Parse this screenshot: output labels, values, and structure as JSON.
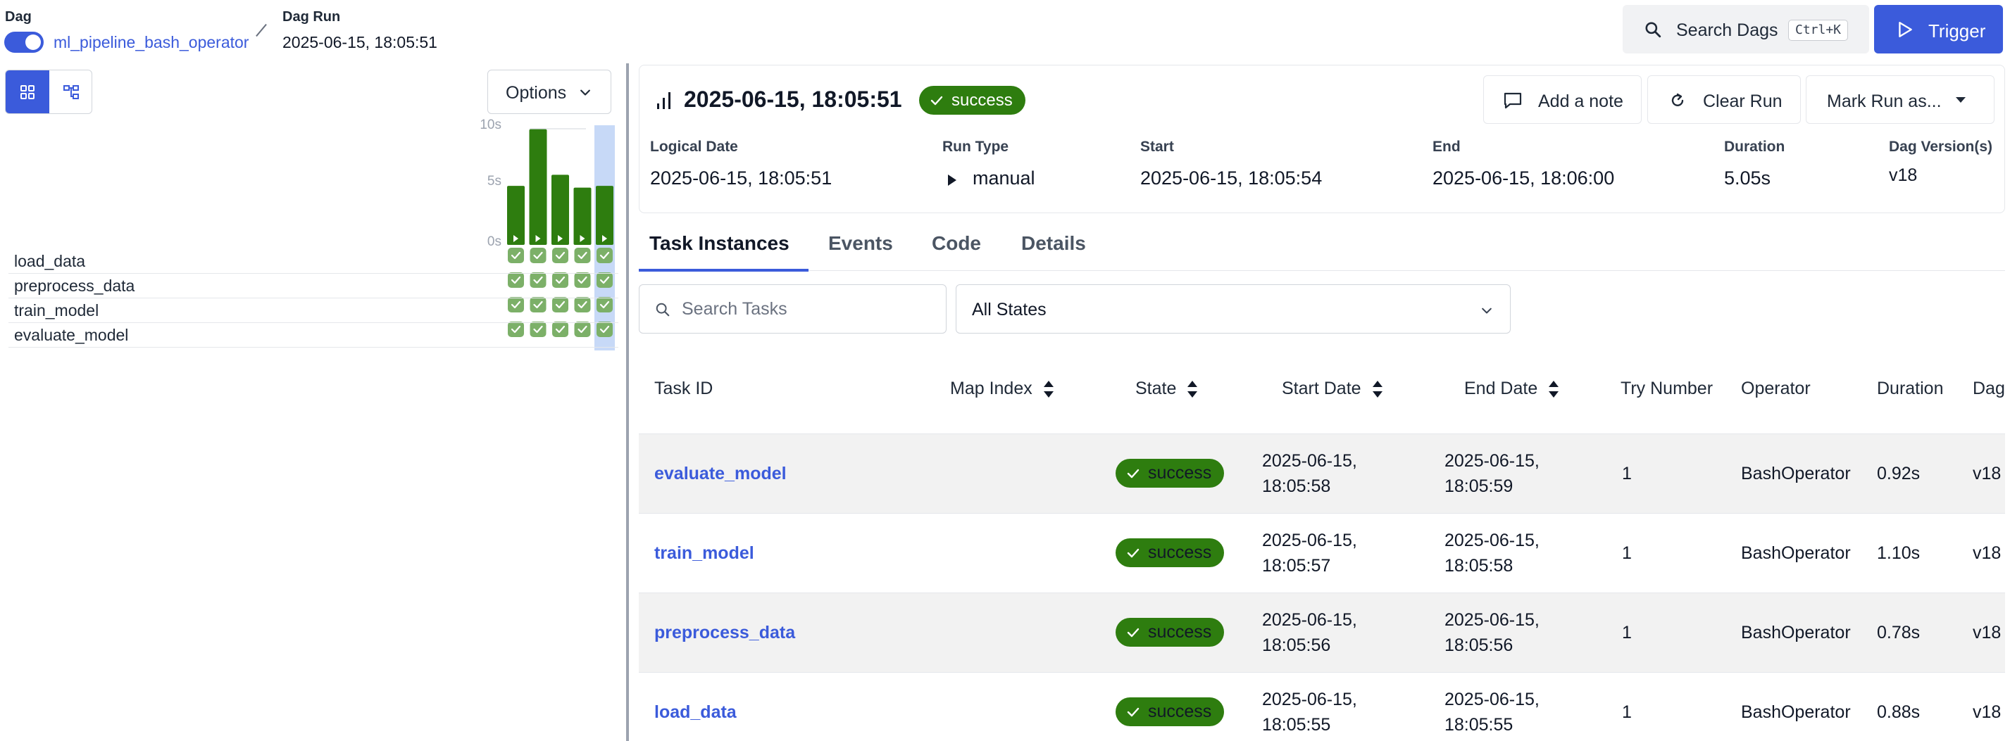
{
  "breadcrumb": {
    "dag_label": "Dag",
    "dag_name": "ml_pipeline_bash_operator",
    "run_label": "Dag Run",
    "run_value": "2025-06-15, 18:05:51"
  },
  "search_dags": {
    "label": "Search Dags",
    "shortcut": "Ctrl+K"
  },
  "trigger": {
    "label": "Trigger"
  },
  "grid": {
    "options_label": "Options",
    "axis_ticks": [
      "10s",
      "5s",
      "0s"
    ],
    "run_durations_s": [
      5.05,
      9.9,
      6.0,
      4.9,
      5.05
    ],
    "task_names": [
      "load_data",
      "preprocess_data",
      "train_model",
      "evaluate_model"
    ]
  },
  "run": {
    "title": "2025-06-15, 18:05:51",
    "state": "success",
    "add_note": "Add a note",
    "clear_run": "Clear Run",
    "mark_run": "Mark Run as...",
    "meta": [
      {
        "label": "Logical Date",
        "value": "2025-06-15, 18:05:51"
      },
      {
        "label": "Run Type",
        "value": "manual"
      },
      {
        "label": "Start",
        "value": "2025-06-15, 18:05:54"
      },
      {
        "label": "End",
        "value": "2025-06-15, 18:06:00"
      },
      {
        "label": "Duration",
        "value": "5.05s"
      },
      {
        "label": "Dag Version(s)",
        "value": "v18"
      }
    ]
  },
  "tabs": [
    "Task Instances",
    "Events",
    "Code",
    "Details"
  ],
  "filters": {
    "search_placeholder": "Search Tasks",
    "state_select": "All States"
  },
  "table": {
    "headers": [
      "Task ID",
      "Map Index",
      "State",
      "Start Date",
      "End Date",
      "Try Number",
      "Operator",
      "Duration",
      "Dag"
    ],
    "rows": [
      {
        "task_id": "evaluate_model",
        "state": "success",
        "start_date": "2025-06-15,",
        "start_time": "18:05:58",
        "end_date": "2025-06-15,",
        "end_time": "18:05:59",
        "try": "1",
        "operator": "BashOperator",
        "duration": "0.92s",
        "dag": "v18"
      },
      {
        "task_id": "train_model",
        "state": "success",
        "start_date": "2025-06-15,",
        "start_time": "18:05:57",
        "end_date": "2025-06-15,",
        "end_time": "18:05:58",
        "try": "1",
        "operator": "BashOperator",
        "duration": "1.10s",
        "dag": "v18"
      },
      {
        "task_id": "preprocess_data",
        "state": "success",
        "start_date": "2025-06-15,",
        "start_time": "18:05:56",
        "end_date": "2025-06-15,",
        "end_time": "18:05:56",
        "try": "1",
        "operator": "BashOperator",
        "duration": "0.78s",
        "dag": "v18"
      },
      {
        "task_id": "load_data",
        "state": "success",
        "start_date": "2025-06-15,",
        "start_time": "18:05:55",
        "end_date": "2025-06-15,",
        "end_time": "18:05:55",
        "try": "1",
        "operator": "BashOperator",
        "duration": "0.88s",
        "dag": "v18"
      }
    ]
  },
  "colors": {
    "accent": "#3b5bdb",
    "success": "#2e7d0f",
    "success_light": "#7cb068",
    "selected_col": "#c7d9f7"
  }
}
